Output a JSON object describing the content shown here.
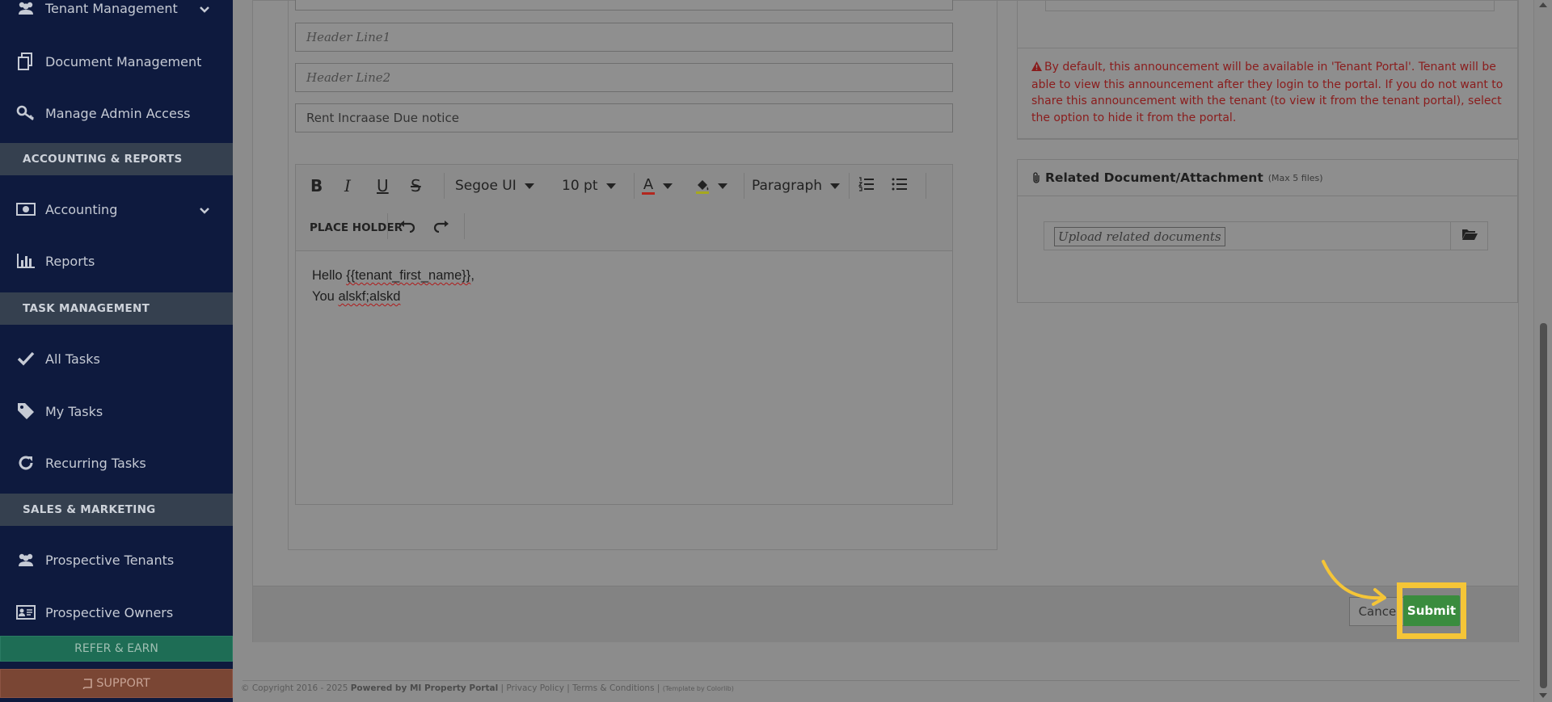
{
  "sidebar": {
    "items": [
      {
        "label": "Tenant Management",
        "icon": "users-icon",
        "has_chevron": true
      },
      {
        "label": "Document Management",
        "icon": "documents-icon"
      },
      {
        "label": "Manage Admin Access",
        "icon": "key-icon"
      },
      {
        "label": "Accounting",
        "icon": "money-icon",
        "has_chevron": true
      },
      {
        "label": "Reports",
        "icon": "bar-chart-icon"
      },
      {
        "label": "All Tasks",
        "icon": "check-icon"
      },
      {
        "label": "My Tasks",
        "icon": "tag-icon"
      },
      {
        "label": "Recurring Tasks",
        "icon": "refresh-icon"
      },
      {
        "label": "Prospective Tenants",
        "icon": "users-icon"
      },
      {
        "label": "Prospective Owners",
        "icon": "id-card-icon"
      }
    ],
    "sections": {
      "accounting": "ACCOUNTING & REPORTS",
      "tasks": "TASK MANAGEMENT",
      "sales": "SALES & MARKETING"
    },
    "refer_label": "REFER & EARN",
    "support_label": "SUPPORT"
  },
  "form": {
    "header_line1_placeholder": "Header Line1",
    "header_line2_placeholder": "Header Line2",
    "subject_value": "Rent Incraase Due notice"
  },
  "editor": {
    "font_family": "Segoe UI",
    "font_size": "10 pt",
    "block_format": "Paragraph",
    "placeholder_button": "PLACE HOLDER",
    "body_line1_prefix": "Hello ",
    "body_line1_token": "{{tenant_first_name}}",
    "body_line1_suffix": ",",
    "body_line2_prefix": "You ",
    "body_line2_word": "alskf;alskd"
  },
  "alert": {
    "text": "By default, this announcement will be available in 'Tenant Portal'. Tenant will be able to view this announcement after they login to the portal. If you do not want to share this announcement with the tenant (to view it from the tenant portal), select the option to hide it from the portal."
  },
  "attachments": {
    "title": "Related Document/Attachment",
    "note": "(Max 5 files)",
    "upload_placeholder": "Upload related documents"
  },
  "actions": {
    "cancel_label": "Cancel",
    "submit_label": "Submit"
  },
  "footer": {
    "copyright_prefix": "© Copyright 2016 - 2025",
    "powered_by": "Powered by MI Property Portal",
    "links": "| Privacy Policy | Terms & Conditions |",
    "template": "(Template by Colorlib)"
  },
  "colors": {
    "sidebar_bg": "#0e1a3e",
    "highlight": "#f5c537",
    "submit_green": "#3a8c3e",
    "alert_red": "#8a1c1c"
  }
}
